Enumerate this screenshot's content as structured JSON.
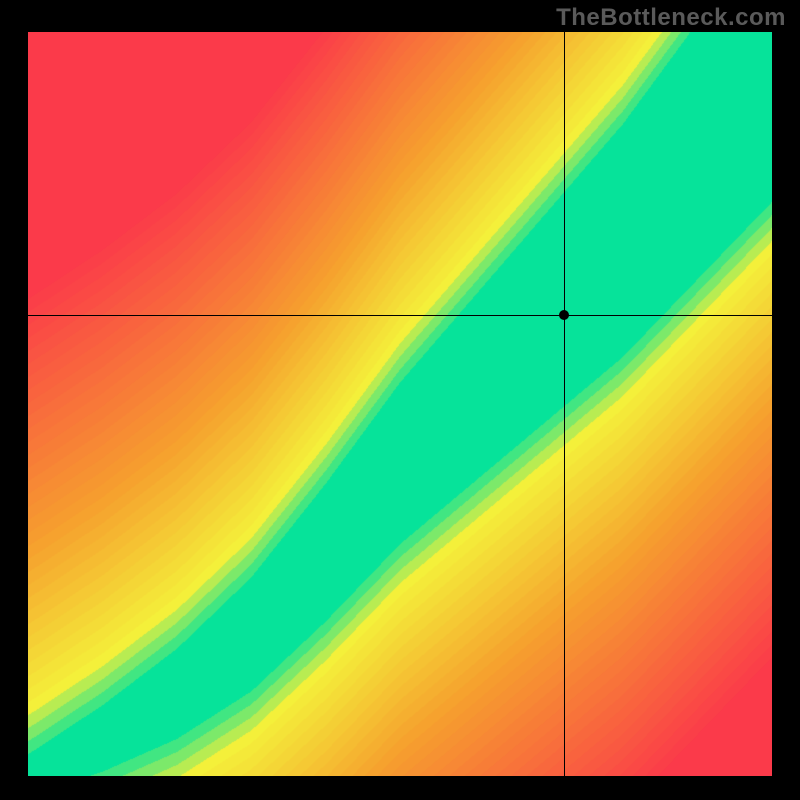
{
  "watermark": "TheBottleneck.com",
  "chart_data": {
    "type": "heatmap",
    "title": "",
    "xlabel": "",
    "ylabel": "",
    "xlim": [
      0,
      100
    ],
    "ylim": [
      0,
      100
    ],
    "crosshair": {
      "x": 72,
      "y": 62
    },
    "palette_note": "centered green band along rising diagonal curve; transitions through yellow to orange then red with distance from the band; top-right corner trends toward green/cyan, bottom-left and off-diagonal corners trend red/orange",
    "curve": [
      {
        "x": 0,
        "y": 0
      },
      {
        "x": 10,
        "y": 5
      },
      {
        "x": 20,
        "y": 11
      },
      {
        "x": 30,
        "y": 19
      },
      {
        "x": 40,
        "y": 30
      },
      {
        "x": 50,
        "y": 42
      },
      {
        "x": 60,
        "y": 52
      },
      {
        "x": 70,
        "y": 62
      },
      {
        "x": 80,
        "y": 72
      },
      {
        "x": 90,
        "y": 84
      },
      {
        "x": 100,
        "y": 96
      }
    ],
    "band_width_start": 2,
    "band_width_end": 18,
    "colors": {
      "center": "#06e39a",
      "near": "#f4f03a",
      "mid": "#f6a22e",
      "far": "#fb3a4a"
    }
  }
}
